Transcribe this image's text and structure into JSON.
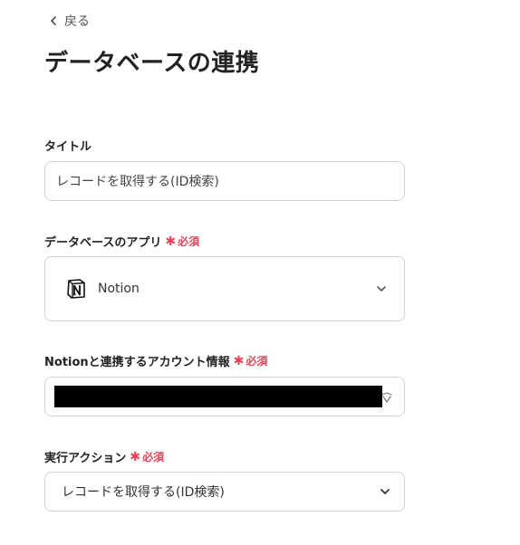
{
  "nav": {
    "back_label": "戻る"
  },
  "page": {
    "title": "データベースの連携"
  },
  "fields": {
    "title_label": "タイトル",
    "title_value": "レコードを取得する(ID検索)",
    "app_label": "データベースのアプリ",
    "app_value": "Notion",
    "account_label": "Notionと連携するアカウント情報",
    "action_label": "実行アクション",
    "action_value": "レコードを取得する(ID検索)"
  },
  "required": {
    "star": "✱",
    "text": "必須"
  },
  "icons": {
    "back": "chevron-left-icon",
    "app_logo": "notion-logo",
    "dropdown": "chevron-down-icon",
    "account": "refresh-icon"
  },
  "colors": {
    "required": "#e8445a",
    "border": "#cfd4da"
  }
}
